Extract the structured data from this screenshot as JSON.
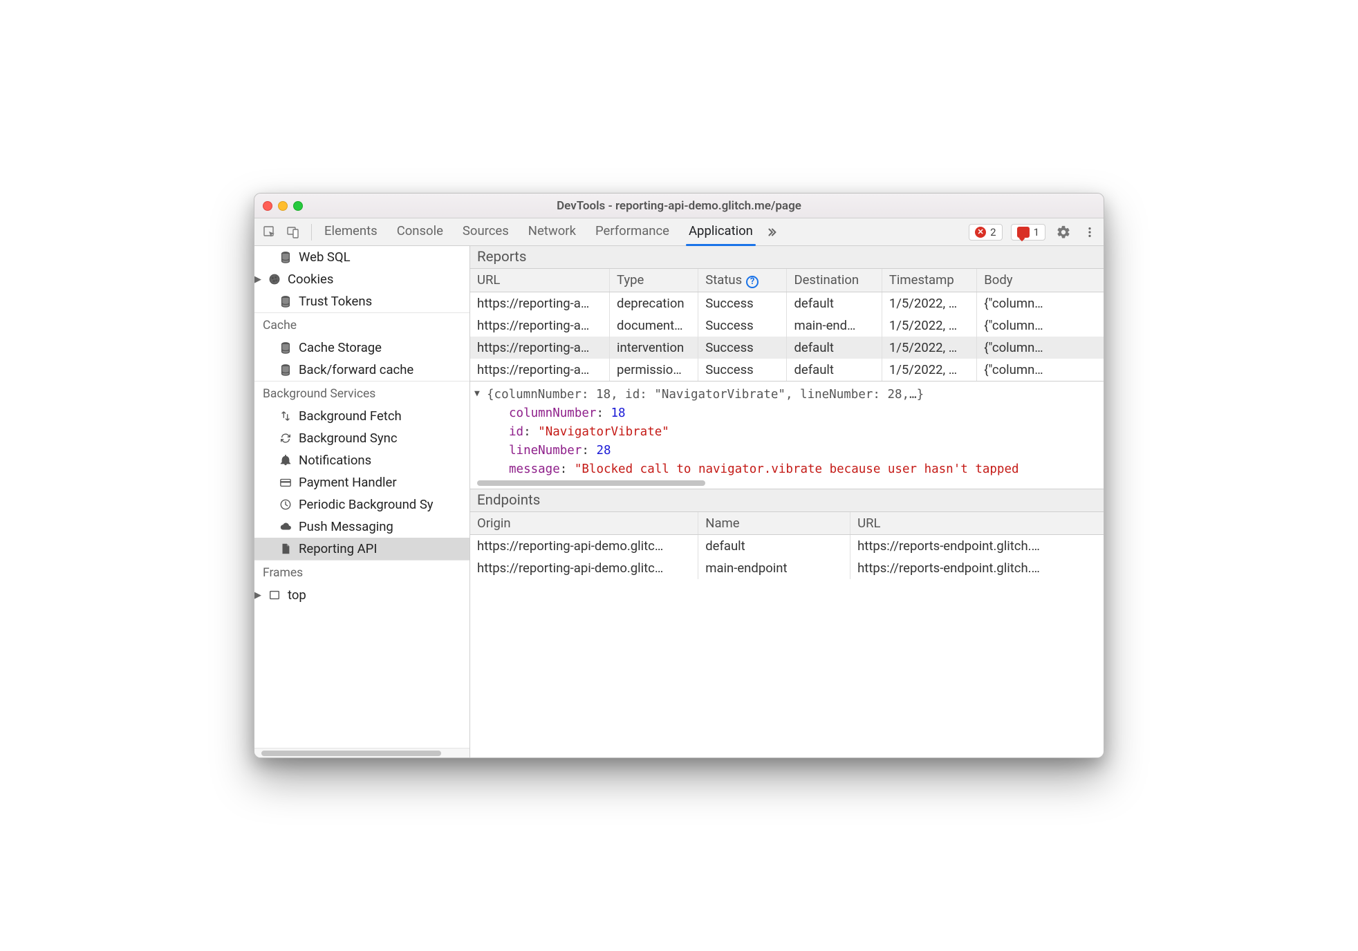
{
  "title": "DevTools - reporting-api-demo.glitch.me/page",
  "toolbar": {
    "tabs": [
      "Elements",
      "Console",
      "Sources",
      "Network",
      "Performance",
      "Application"
    ],
    "active_tab_index": 5,
    "error_count": "2",
    "alert_count": "1"
  },
  "sidebar": {
    "pregroup": [
      {
        "icon": "database-icon",
        "label": "Web SQL",
        "indent": 1
      },
      {
        "icon": "cookie-icon",
        "label": "Cookies",
        "indent": 1,
        "disclosure": true
      },
      {
        "icon": "database-icon",
        "label": "Trust Tokens",
        "indent": 1
      }
    ],
    "groups": [
      {
        "name": "Cache",
        "items": [
          {
            "icon": "database-icon",
            "label": "Cache Storage"
          },
          {
            "icon": "database-icon",
            "label": "Back/forward cache"
          }
        ]
      },
      {
        "name": "Background Services",
        "items": [
          {
            "icon": "fetch-icon",
            "label": "Background Fetch"
          },
          {
            "icon": "sync-icon",
            "label": "Background Sync"
          },
          {
            "icon": "bell-icon",
            "label": "Notifications"
          },
          {
            "icon": "card-icon",
            "label": "Payment Handler"
          },
          {
            "icon": "clock-icon",
            "label": "Periodic Background Sy"
          },
          {
            "icon": "cloud-icon",
            "label": "Push Messaging"
          },
          {
            "icon": "file-icon",
            "label": "Reporting API",
            "selected": true
          }
        ]
      },
      {
        "name": "Frames",
        "items": [
          {
            "icon": "frame-icon",
            "label": "top",
            "disclosure": true
          }
        ]
      }
    ]
  },
  "reports": {
    "title": "Reports",
    "columns": [
      "URL",
      "Type",
      "Status",
      "Destination",
      "Timestamp",
      "Body"
    ],
    "status_help": true,
    "rows": [
      {
        "url": "https://reporting-a…",
        "type": "deprecation",
        "status": "Success",
        "destination": "default",
        "timestamp": "1/5/2022, …",
        "body": "{\"column…"
      },
      {
        "url": "https://reporting-a…",
        "type": "document…",
        "status": "Success",
        "destination": "main-end…",
        "timestamp": "1/5/2022, …",
        "body": "{\"column…"
      },
      {
        "url": "https://reporting-a…",
        "type": "intervention",
        "status": "Success",
        "destination": "default",
        "timestamp": "1/5/2022, …",
        "body": "{\"column…",
        "selected": true
      },
      {
        "url": "https://reporting-a…",
        "type": "permissio…",
        "status": "Success",
        "destination": "default",
        "timestamp": "1/5/2022, …",
        "body": "{\"column…"
      }
    ]
  },
  "detail": {
    "summary": "{columnNumber: 18, id: \"NavigatorVibrate\", lineNumber: 28,…}",
    "columnNumber": "18",
    "id": "\"NavigatorVibrate\"",
    "lineNumber": "28",
    "message": "\"Blocked call to navigator.vibrate because user hasn't tapped"
  },
  "endpoints": {
    "title": "Endpoints",
    "columns": [
      "Origin",
      "Name",
      "URL"
    ],
    "rows": [
      {
        "origin": "https://reporting-api-demo.glitc…",
        "name": "default",
        "url": "https://reports-endpoint.glitch.…"
      },
      {
        "origin": "https://reporting-api-demo.glitc…",
        "name": "main-endpoint",
        "url": "https://reports-endpoint.glitch.…"
      }
    ]
  }
}
